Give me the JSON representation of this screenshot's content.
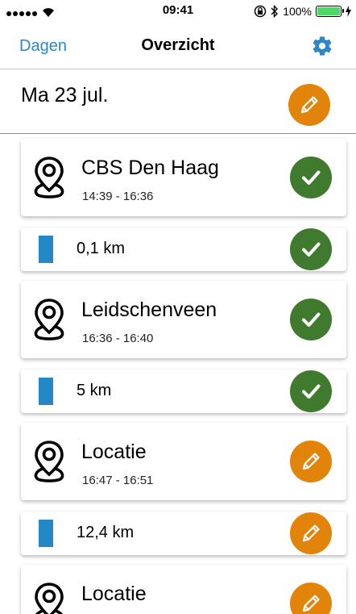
{
  "status_bar": {
    "time": "09:41",
    "battery": "100%"
  },
  "nav": {
    "back_label": "Dagen",
    "title": "Overzicht",
    "settings_icon": "gear-icon"
  },
  "date": {
    "label": "Ma 23 jul.",
    "edit_icon": "pencil-icon"
  },
  "items": [
    {
      "type": "location",
      "title": "CBS Den Haag",
      "time": "14:39 - 16:36",
      "status": "confirmed"
    },
    {
      "type": "trip",
      "distance": "0,1 km",
      "status": "confirmed"
    },
    {
      "type": "location",
      "title": "Leidschenveen",
      "time": "16:36 - 16:40",
      "status": "confirmed"
    },
    {
      "type": "trip",
      "distance": "5 km",
      "status": "confirmed"
    },
    {
      "type": "location",
      "title": "Locatie",
      "time": "16:47 - 16:51",
      "status": "edit"
    },
    {
      "type": "trip",
      "distance": "12,4 km",
      "status": "edit"
    },
    {
      "type": "location",
      "title": "Locatie",
      "time": "",
      "status": "edit"
    }
  ],
  "colors": {
    "accent_blue": "#2d87c8",
    "confirm_green": "#3f7a2e",
    "edit_orange": "#e3840a",
    "trip_bar": "#2487c6"
  }
}
